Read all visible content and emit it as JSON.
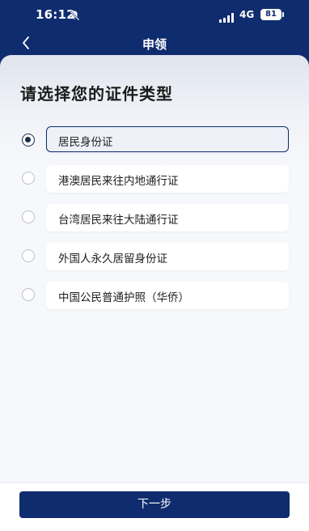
{
  "status_bar": {
    "time": "16:12",
    "network": "4G",
    "battery": "81",
    "icons": [
      "bell-muted-icon",
      "signal-icon",
      "battery-icon"
    ]
  },
  "nav": {
    "back_icon": "chevron-left-icon",
    "title": "申领"
  },
  "page": {
    "title": "请选择您的证件类型"
  },
  "options": [
    {
      "label": "居民身份证",
      "selected": true
    },
    {
      "label": "港澳居民来往内地通行证",
      "selected": false
    },
    {
      "label": "台湾居民来往大陆通行证",
      "selected": false
    },
    {
      "label": "外国人永久居留身份证",
      "selected": false
    },
    {
      "label": "中国公民普通护照（华侨）",
      "selected": false
    }
  ],
  "footer": {
    "next_label": "下一步"
  },
  "colors": {
    "primary": "#0f2c6e",
    "background": "#f7f8fb",
    "text": "#1e1e1e"
  }
}
